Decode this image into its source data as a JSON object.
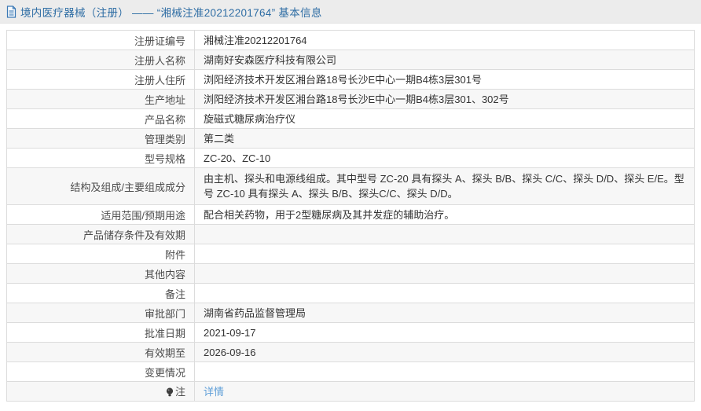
{
  "header": {
    "title": "境内医疗器械（注册） —— “湘械注准20212201764” 基本信息"
  },
  "colors": {
    "title_blue": "#2e6da4",
    "link_blue": "#5f9fd8",
    "header_bg": "#ececec",
    "alt_row_bg": "#f7f7f7",
    "border": "#dcdcdc"
  },
  "icons": {
    "title_icon": "document-icon",
    "note_row_icon": "note-bulb-icon"
  },
  "table": {
    "rows": [
      {
        "label": "注册证编号",
        "value": "湘械注准20212201764"
      },
      {
        "label": "注册人名称",
        "value": "湖南好安森医疗科技有限公司"
      },
      {
        "label": "注册人住所",
        "value": "浏阳经济技术开发区湘台路18号长沙E中心一期B4栋3层301号"
      },
      {
        "label": "生产地址",
        "value": "浏阳经济技术开发区湘台路18号长沙E中心一期B4栋3层301、302号"
      },
      {
        "label": "产品名称",
        "value": "旋磁式糖尿病治疗仪"
      },
      {
        "label": "管理类别",
        "value": "第二类"
      },
      {
        "label": "型号规格",
        "value": "ZC-20、ZC-10"
      },
      {
        "label": "结构及组成/主要组成成分",
        "value": "由主机、探头和电源线组成。其中型号 ZC-20 具有探头 A、探头 B/B、探头 C/C、探头 D/D、探头 E/E。型号 ZC-10 具有探头 A、探头 B/B、探头C/C、探头 D/D。"
      },
      {
        "label": "适用范围/预期用途",
        "value": "配合相关药物，用于2型糖尿病及其并发症的辅助治疗。"
      },
      {
        "label": "产品储存条件及有效期",
        "value": ""
      },
      {
        "label": "附件",
        "value": ""
      },
      {
        "label": "其他内容",
        "value": ""
      },
      {
        "label": "备注",
        "value": ""
      },
      {
        "label": "审批部门",
        "value": "湖南省药品监督管理局"
      },
      {
        "label": "批准日期",
        "value": "2021-09-17"
      },
      {
        "label": "有效期至",
        "value": "2026-09-16"
      },
      {
        "label": "变更情况",
        "value": ""
      },
      {
        "label": "注",
        "value": "详情"
      }
    ]
  }
}
